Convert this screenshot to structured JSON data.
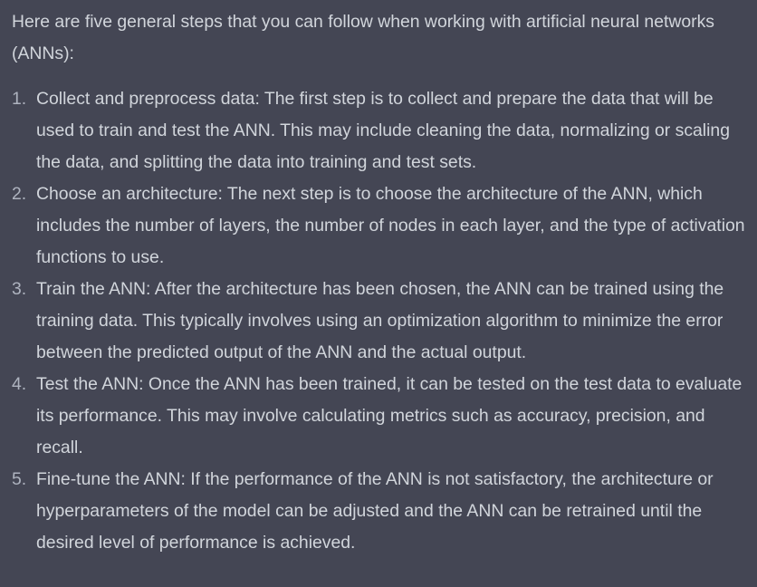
{
  "intro": "Here are five general steps that you can follow when working with artificial neural networks (ANNs):",
  "steps": [
    {
      "number": "1.",
      "text": "Collect and preprocess data: The first step is to collect and prepare the data that will be used to train and test the ANN. This may include cleaning the data, normalizing or scaling the data, and splitting the data into training and test sets."
    },
    {
      "number": "2.",
      "text": "Choose an architecture: The next step is to choose the architecture of the ANN, which includes the number of layers, the number of nodes in each layer, and the type of activation functions to use."
    },
    {
      "number": "3.",
      "text": "Train the ANN: After the architecture has been chosen, the ANN can be trained using the training data. This typically involves using an optimization algorithm to minimize the error between the predicted output of the ANN and the actual output."
    },
    {
      "number": "4.",
      "text": "Test the ANN: Once the ANN has been trained, it can be tested on the test data to evaluate its performance. This may involve calculating metrics such as accuracy, precision, and recall."
    },
    {
      "number": "5.",
      "text": "Fine-tune the ANN: If the performance of the ANN is not satisfactory, the architecture or hyperparameters of the model can be adjusted and the ANN can be retrained until the desired level of performance is achieved."
    }
  ],
  "colors": {
    "background": "#444654",
    "text": "#d1d5db",
    "list_number": "#aeb3bf"
  }
}
